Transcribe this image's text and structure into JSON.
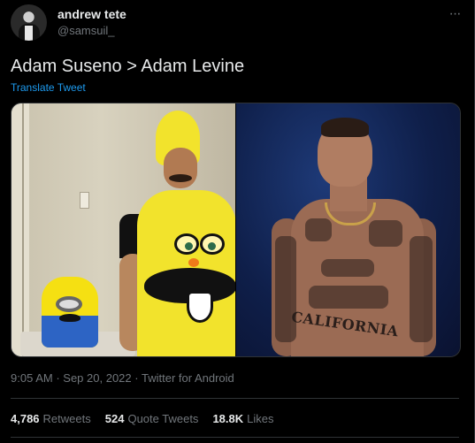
{
  "author": {
    "name": "andrew tete",
    "handle": "@samsuil_"
  },
  "more_icon": "more-horizontal-icon",
  "tweet": {
    "text": "Adam Suseno > Adam Levine",
    "translate_label": "Translate Tweet"
  },
  "media": {
    "right_photo_tattoo_text": "CALIFORNIA"
  },
  "meta": {
    "time": "9:05 AM",
    "dot": "·",
    "date": "Sep 20, 2022",
    "source": "Twitter for Android"
  },
  "stats": {
    "retweets": {
      "count": "4,786",
      "label": "Retweets"
    },
    "quote_tweets": {
      "count": "524",
      "label": "Quote Tweets"
    },
    "likes": {
      "count": "18.8K",
      "label": "Likes"
    }
  },
  "colors": {
    "background": "#000000",
    "text_primary": "#e7e9ea",
    "text_secondary": "#71767b",
    "link": "#1d9bf0",
    "border": "#2f3336"
  }
}
